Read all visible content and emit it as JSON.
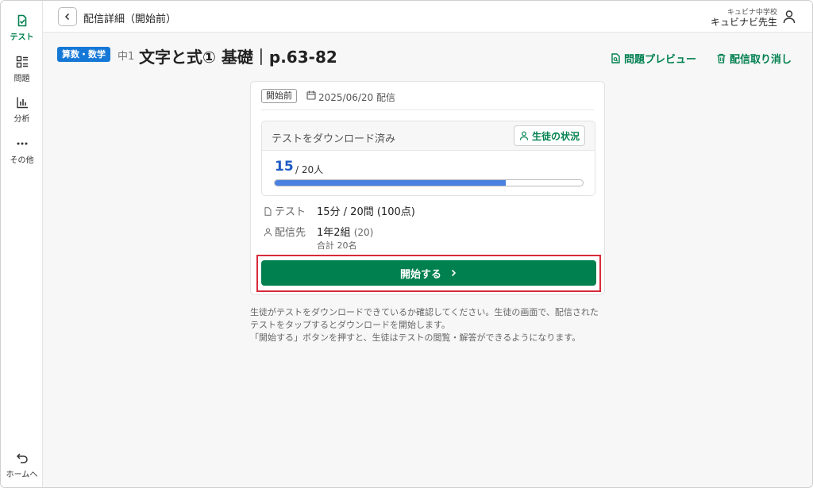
{
  "sidebar": {
    "items": [
      {
        "label": "テスト",
        "icon": "test-check-icon",
        "active": true
      },
      {
        "label": "問題",
        "icon": "problems-icon",
        "active": false
      },
      {
        "label": "分析",
        "icon": "analytics-icon",
        "active": false
      },
      {
        "label": "その他",
        "icon": "more-icon",
        "active": false
      }
    ],
    "home_label": "ホームへ"
  },
  "header": {
    "title": "配信詳細（開始前）",
    "school": "キュビナ中学校",
    "teacher": "キュビナビ先生"
  },
  "title_row": {
    "subject": "算数・数学",
    "grade": "中1",
    "title": "文字と式① 基礎｜p.63-82",
    "preview_label": "問題プレビュー",
    "cancel_label": "配信取り消し"
  },
  "card": {
    "status": "開始前",
    "date": "2025/06/20 配信",
    "download_label": "テストをダウンロード済み",
    "student_status_label": "生徒の状況",
    "downloaded_count": "15",
    "total_text": "/ 20人",
    "progress": 0.75,
    "test_label": "テスト",
    "test_value": "15分 / 20問 (100点)",
    "dest_label": "配信先",
    "dest_value": "1年2組",
    "dest_count": "(20)",
    "dest_total": "合計 20名",
    "start_label": "開始する"
  },
  "notes": [
    "生徒がテストをダウンロードできているか確認してください。生徒の画面で、配信された",
    "テストをタップするとダウンロードを開始します。",
    "「開始する」ボタンを押すと、生徒はテストの閲覧・解答ができるようになります。"
  ],
  "colors": {
    "accent": "#00804f",
    "badge": "#1678d6",
    "count": "#1f5bc4",
    "progress": "#4a81e0",
    "highlight": "#d62b3b"
  }
}
